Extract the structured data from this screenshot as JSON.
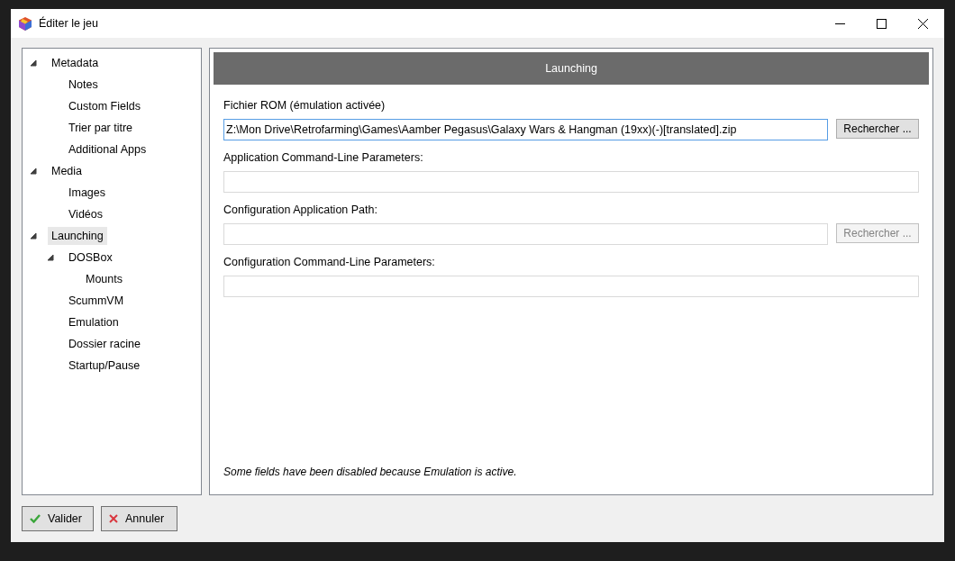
{
  "window": {
    "title": "Éditer le jeu"
  },
  "tree": [
    {
      "label": "Metadata",
      "expanded": true,
      "selected": false,
      "children": [
        {
          "label": "Notes",
          "selected": false
        },
        {
          "label": "Custom Fields",
          "selected": false
        },
        {
          "label": "Trier par titre",
          "selected": false
        },
        {
          "label": "Additional Apps",
          "selected": false
        }
      ]
    },
    {
      "label": "Media",
      "expanded": true,
      "selected": false,
      "children": [
        {
          "label": "Images",
          "selected": false
        },
        {
          "label": "Vidéos",
          "selected": false
        }
      ]
    },
    {
      "label": "Launching",
      "expanded": true,
      "selected": true,
      "children": [
        {
          "label": "DOSBox",
          "expanded": true,
          "selected": false,
          "children": [
            {
              "label": "Mounts",
              "selected": false
            }
          ]
        },
        {
          "label": "ScummVM",
          "selected": false
        },
        {
          "label": "Emulation",
          "selected": false
        },
        {
          "label": "Dossier racine",
          "selected": false
        },
        {
          "label": "Startup/Pause",
          "selected": false
        }
      ]
    }
  ],
  "panel": {
    "header": "Launching",
    "fields": [
      {
        "label": "Fichier ROM (émulation activée)",
        "value": "Z:\\Mon Drive\\Retrofarming\\Games\\Aamber Pegasus\\Galaxy Wars & Hangman (19xx)(-)[translated].zip",
        "focused": true,
        "disabled": false,
        "button": {
          "label": "Rechercher ...",
          "disabled": false
        }
      },
      {
        "label": "Application Command-Line Parameters:",
        "focused": false,
        "disabled": true
      },
      {
        "label": "Configuration Application Path:",
        "focused": false,
        "disabled": true,
        "button": {
          "label": "Rechercher ...",
          "disabled": true
        }
      },
      {
        "label": "Configuration Command-Line Parameters:",
        "focused": false,
        "disabled": true
      }
    ],
    "note": "Some fields have been disabled because Emulation is active."
  },
  "buttons": [
    {
      "label": "Valider",
      "kind": "ok"
    },
    {
      "label": "Annuler",
      "kind": "cancel"
    }
  ]
}
